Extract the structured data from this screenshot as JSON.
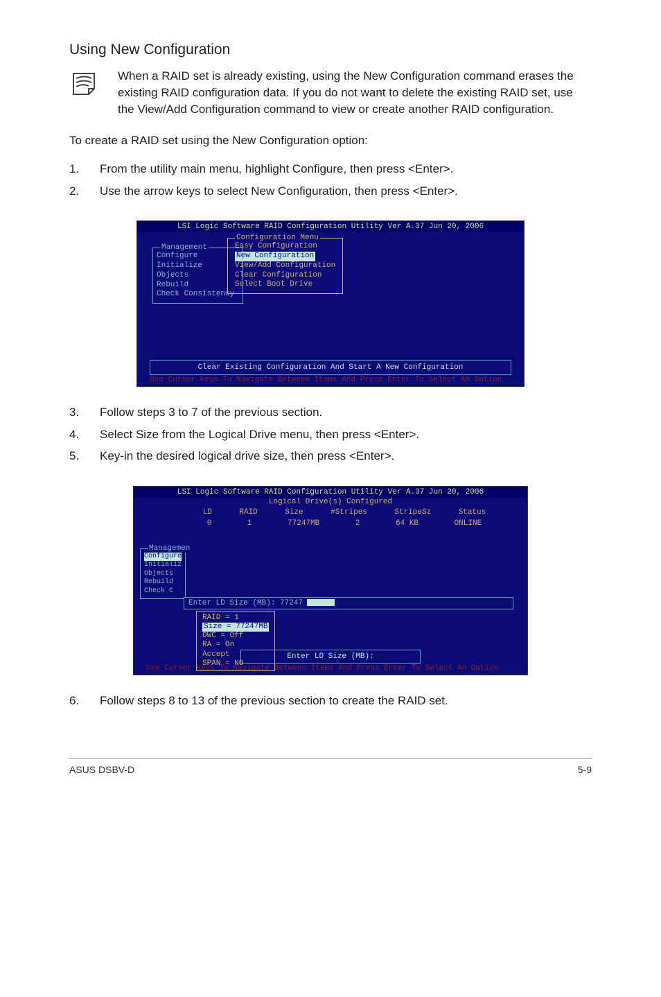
{
  "heading": "Using New Configuration",
  "note": "When a RAID set is already existing, using the New Configuration command erases the existing RAID configuration data. If you do not want to delete the existing RAID set, use the View/Add Configuration command to view or create another RAID configuration.",
  "intro": "To create a RAID set using the New Configuration option:",
  "steps_a": [
    {
      "n": "1.",
      "t": "From the utility main menu, highlight Configure, then press <Enter>."
    },
    {
      "n": "2.",
      "t": "Use the arrow keys to select New Configuration, then press <Enter>."
    }
  ],
  "term1": {
    "title": "LSI Logic Software RAID Configuration Utility Ver A.37 Jun 20, 2006",
    "management_label": "Management",
    "management_items": [
      "Configure",
      "Initialize",
      "Objects",
      "Rebuild",
      "Check Consistency"
    ],
    "config_label": "Configuration Menu",
    "config_items": [
      "Easy Configuration",
      "New Configuration",
      "View/Add Configuration",
      "Clear Configuration",
      "Select Boot Drive"
    ],
    "config_selected_index": 1,
    "bottom_msg": "Clear Existing Configuration And Start A New Configuration",
    "hint": "Use Cursor Keys To Navigate Between Items And Press Enter To Select An Option"
  },
  "steps_b": [
    {
      "n": "3.",
      "t": "Follow steps 3 to 7 of the previous section."
    },
    {
      "n": "4.",
      "t": "Select Size from the Logical Drive menu, then press <Enter>."
    },
    {
      "n": "5.",
      "t": "Key-in the desired logical drive size, then press <Enter>."
    }
  ],
  "term2": {
    "title": "LSI Logic Software RAID Configuration Utility Ver A.37 Jun 20, 2006",
    "subtitle": "Logical Drive(s) Configured",
    "headers": [
      "LD",
      "RAID",
      "Size",
      "#Stripes",
      "StripeSz",
      "Status"
    ],
    "row": [
      "0",
      "1",
      "77247MB",
      "2",
      "64  KB",
      "ONLINE"
    ],
    "management_label": "Managemen",
    "management_items": [
      "Configure",
      "Initializ",
      "Objects",
      "Rebuild",
      "Check C"
    ],
    "size_bar": "Enter LD Size (MB): 77247",
    "raid_lines": [
      "RAID = 1",
      "Size = 77247MB",
      "DWC  = Off",
      "RA   = On",
      "Accept",
      "SPAN = NO"
    ],
    "raid_highlight_index": 1,
    "enter_box": "Enter LD Size (MB):",
    "hint": "Use Cursor Keys To Navigate Between Items And Press Enter To Select An Option"
  },
  "steps_c": [
    {
      "n": "6.",
      "t": "Follow steps 8 to 13 of the previous section to create the RAID set."
    }
  ],
  "footer_left": "ASUS DSBV-D",
  "footer_right": "5-9"
}
